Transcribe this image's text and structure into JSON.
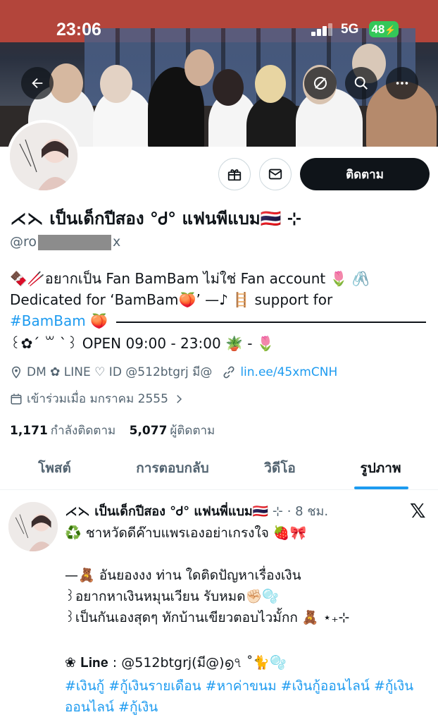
{
  "status_bar": {
    "time": "23:06",
    "network": "5G",
    "battery": "48"
  },
  "header_actions": {
    "back": "back",
    "unfollow": "unfollow",
    "search": "search",
    "more": "more"
  },
  "profile": {
    "name": "⋌⋋ เป็นเด็กปีสอง °Ꮷ° แฟนพีแบม🇹🇭 ⊹",
    "handle_prefix": "@ro",
    "handle_suffix": "x",
    "follow_label": "ติดตาม",
    "bio_line1": "🍫🥢อยากเป็น Fan BamBam ไม่ใช่ Fan account 🌷 🖇️",
    "bio_line2": "Dedicated for ‘BamBam🍑’ —♪ 🪜 support for",
    "bio_hashtag": "#BamBam",
    "bio_hashtag_emoji": "🍑",
    "bio_line4": "꒰✿´ ꒳ `꒱ OPEN 09:00 - 23:00 🪴 - 🌷",
    "location": "DM ✿ LINE ♡ ID @512btgrj มี@",
    "website": "lin.ee/45xmCNH",
    "joined": "เข้าร่วมเมื่อ มกราคม 2555",
    "following_count": "1,171",
    "following_label": "กำลังติดตาม",
    "followers_count": "5,077",
    "followers_label": "ผู้ติดตาม"
  },
  "tabs": [
    {
      "label": "โพสต์"
    },
    {
      "label": "การตอบกลับ"
    },
    {
      "label": "วิดีโอ"
    },
    {
      "label": "รูปภาพ"
    }
  ],
  "post": {
    "author": "⋌⋋ เป็นเด็กปีสอง °Ꮷ° แฟนพี่แบม🇹🇭",
    "meta": "⊹ · 8 ชม.",
    "line1": "♻️ ชาหวัดดีค๊าบแพรเองอย่าเกรงใจ 🍓🎀",
    "line2": "—🧸 อันยองงง ท่าน ใดติดปัญหาเรื่องเงิน",
    "line3": "꒱อยากหาเงินหมุนเวียน รับหมด✊🏻🫧",
    "line4": "꒱เป็นกันเองสุดๆ ทักบ้านเขียวตอบไวมั้กก 🧸 ⋆₊⊹",
    "line5": "❀ 𝐋𝐢𝐧𝐞 : @512btgrj(มี@)൭৭ ˚🐈🫧",
    "hashtags": "#เงินกู้ #กู้เงินรายเดือน #หาค่าขนม #เงินกู้ออนไลน์ #กู้เงินออนไลน์ #กู้เงิน"
  },
  "colors": {
    "accent": "#1d9bf0",
    "text": "#0f1419",
    "muted": "#536471",
    "battery": "#34c759"
  }
}
